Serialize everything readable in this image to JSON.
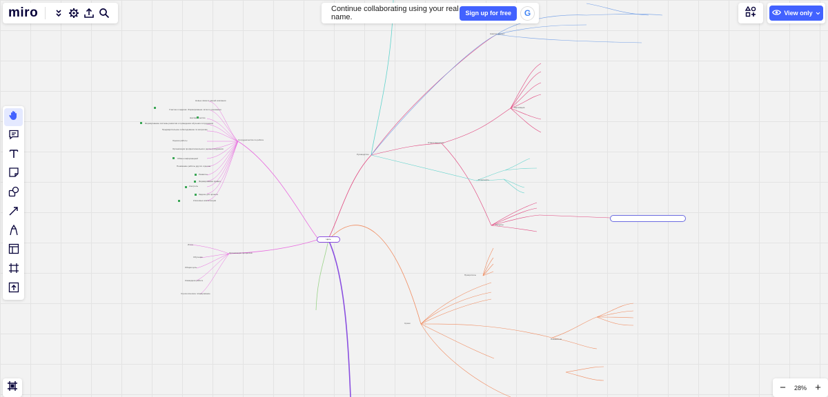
{
  "app": {
    "logo": "miro"
  },
  "banner": {
    "text": "Continue collaborating using your real name.",
    "signup_label": "Sign up for free",
    "google_glyph": "G"
  },
  "view_mode": {
    "label": "View only"
  },
  "zoom": {
    "value": "28%",
    "minus": "−",
    "plus": "+"
  },
  "toolbar_tools": [
    {
      "name": "hand-tool",
      "icon": "hand-icon",
      "active": true
    },
    {
      "name": "comment-tool",
      "icon": "comment-icon",
      "active": false
    },
    {
      "name": "text-tool",
      "icon": "text-icon",
      "active": false
    },
    {
      "name": "sticky-note-tool",
      "icon": "sticky-note-icon",
      "active": false
    },
    {
      "name": "shapes-tool",
      "icon": "shapes-icon",
      "active": false
    },
    {
      "name": "connection-line-tool",
      "icon": "arrow-line-icon",
      "active": false
    },
    {
      "name": "pen-tool",
      "icon": "pen-icon",
      "active": false
    },
    {
      "name": "templates-tool",
      "icon": "templates-icon",
      "active": false
    },
    {
      "name": "frame-tool",
      "icon": "frame-icon",
      "active": false
    },
    {
      "name": "upload-tool",
      "icon": "upload-icon",
      "active": false
    }
  ],
  "top_tools": [
    {
      "name": "menu-chevron",
      "icon": "double-chevron-down-icon"
    },
    {
      "name": "settings",
      "icon": "gear-icon"
    },
    {
      "name": "share",
      "icon": "upload-icon"
    },
    {
      "name": "search",
      "icon": "search-icon"
    }
  ],
  "colors": {
    "accent": "#4262ff",
    "pink_branch": "#e86adf",
    "red_branch": "#e0407a",
    "blue_branch": "#6f9de6",
    "teal_branch": "#5fd3cc",
    "orange_branch": "#f08a5d",
    "purple_branch": "#8a4fe0",
    "green_branch": "#9bd48a"
  },
  "mindmap": {
    "central": "Цель",
    "nodes": [
      {
        "id": "n1",
        "text": "Новые связи в нашей компании"
      },
      {
        "id": "n2",
        "text": "Участие в задачах. Формирование чёткого понимания"
      },
      {
        "id": "n3",
        "text": "Наставничество"
      },
      {
        "id": "n4",
        "text": "Формирование системы развития и проведения обучения сотрудников"
      },
      {
        "id": "n5",
        "text": "Предварительное собеседование по вопросам"
      },
      {
        "id": "n6",
        "text": "Сотрудничество по работе"
      },
      {
        "id": "n7",
        "text": "Оценка работы"
      },
      {
        "id": "n8",
        "text": "Организация профессионального роста сотрудников"
      },
      {
        "id": "n9",
        "text": "Обмен информацией"
      },
      {
        "id": "n10",
        "text": "Понимание работы других отделов"
      },
      {
        "id": "n11",
        "text": "Развитие"
      },
      {
        "id": "n12",
        "text": "Формирование правил"
      },
      {
        "id": "n13",
        "text": "Контроль"
      },
      {
        "id": "n14",
        "text": "Задача для проекта"
      },
      {
        "id": "n15",
        "text": "Ключевые компетенции"
      },
      {
        "id": "n16",
        "text": "Организация процессов"
      },
      {
        "id": "n17",
        "text": "Итоги"
      },
      {
        "id": "n18",
        "text": "Обучение"
      },
      {
        "id": "n19",
        "text": "Общая цель"
      },
      {
        "id": "n20",
        "text": "Командная работа"
      },
      {
        "id": "n21",
        "text": "Стратегическое планирование"
      },
      {
        "id": "n22",
        "text": "Руководство"
      },
      {
        "id": "n23",
        "text": "Ответственность"
      },
      {
        "id": "n24",
        "text": "Мотивация"
      },
      {
        "id": "n25",
        "text": "Анализ данных"
      },
      {
        "id": "n26",
        "text": "Отчётность"
      },
      {
        "id": "n27",
        "text": "Ресурсы"
      },
      {
        "id": "n28",
        "text": "Приоритеты"
      },
      {
        "id": "n29",
        "text": "Сроки"
      },
      {
        "id": "n30",
        "text": "Показатели"
      }
    ]
  }
}
